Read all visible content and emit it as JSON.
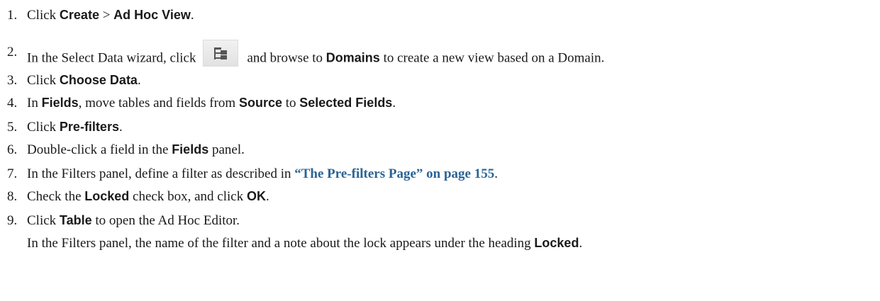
{
  "steps": [
    {
      "num": "1.",
      "t1": "Click ",
      "b1": "Create",
      "t2": " > ",
      "b2": "Ad Hoc View",
      "t3": "."
    },
    {
      "num": "2.",
      "t1": "In the Select Data wizard, click",
      "icon": "tree-view-icon",
      "t2": "and browse to ",
      "b1": "Domains",
      "t3": " to create a new view based on a Domain."
    },
    {
      "num": "3.",
      "t1": "Click ",
      "b1": "Choose Data",
      "t2": "."
    },
    {
      "num": "4.",
      "t1": "In ",
      "b1": "Fields",
      "t2": ", move tables and fields from ",
      "b2": "Source",
      "t3": " to ",
      "b3": "Selected Fields",
      "t4": "."
    },
    {
      "num": "5.",
      "t1": "Click ",
      "b1": "Pre-filters",
      "t2": "."
    },
    {
      "num": "6.",
      "t1": "Double-click a field in the ",
      "b1": "Fields",
      "t2": " panel."
    },
    {
      "num": "7.",
      "t1": "In the Filters panel, define a filter as described in ",
      "link": "“The Pre-filters Page” on page 155",
      "t2": "."
    },
    {
      "num": "8.",
      "t1": "Check the ",
      "b1": "Locked",
      "t2": " check box, and click ",
      "b2": "OK",
      "t3": "."
    },
    {
      "num": "9.",
      "t1": "Click ",
      "b1": "Table",
      "t2": " to open the Ad Hoc Editor."
    }
  ],
  "note": {
    "t1": "In the Filters panel, the name of the filter and a note about the lock appears under the heading ",
    "b1": "Locked",
    "t2": "."
  }
}
